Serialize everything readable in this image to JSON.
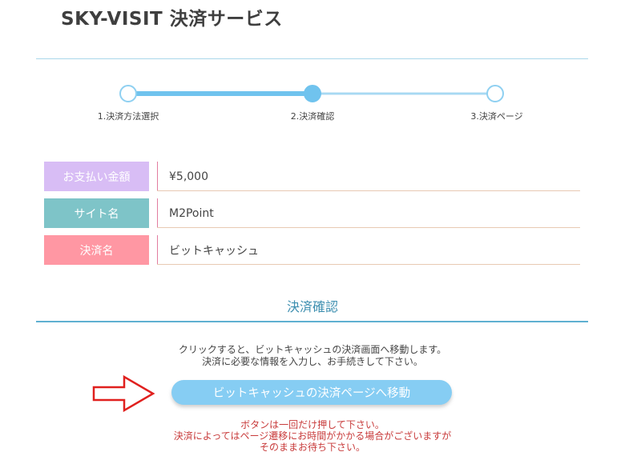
{
  "header": {
    "title": "SKY-VISIT 決済サービス"
  },
  "steps": [
    {
      "label": "1.決済方法選択",
      "active": false
    },
    {
      "label": "2.決済確認",
      "active": true
    },
    {
      "label": "3.決済ページ",
      "active": false
    }
  ],
  "summary": {
    "rows": [
      {
        "label": "お支払い金額",
        "value": "¥5,000",
        "color": "#d8bdf5"
      },
      {
        "label": "サイト名",
        "value": "M2Point",
        "color": "#7ec4c8"
      },
      {
        "label": "決済名",
        "value": "ビットキャッシュ",
        "color": "#ff97a3"
      }
    ]
  },
  "confirm": {
    "section_title": "決済確認",
    "desc_line1": "クリックすると、ビットキャッシュの決済画面へ移動します。",
    "desc_line2": "決済に必要な情報を入力し、お手続きして下さい。",
    "button_label": "ビットキャッシュの決済ページへ移動",
    "notice_line1": "ボタンは一回だけ押して下さい。",
    "notice_line2": "決済によってはページ遷移にお時間がかかる場合がございますが",
    "notice_line3": "そのままお待ち下さい。"
  },
  "colors": {
    "accent": "#70c3ee",
    "notice": "#c83b3b",
    "arrow": "#e0201e"
  }
}
